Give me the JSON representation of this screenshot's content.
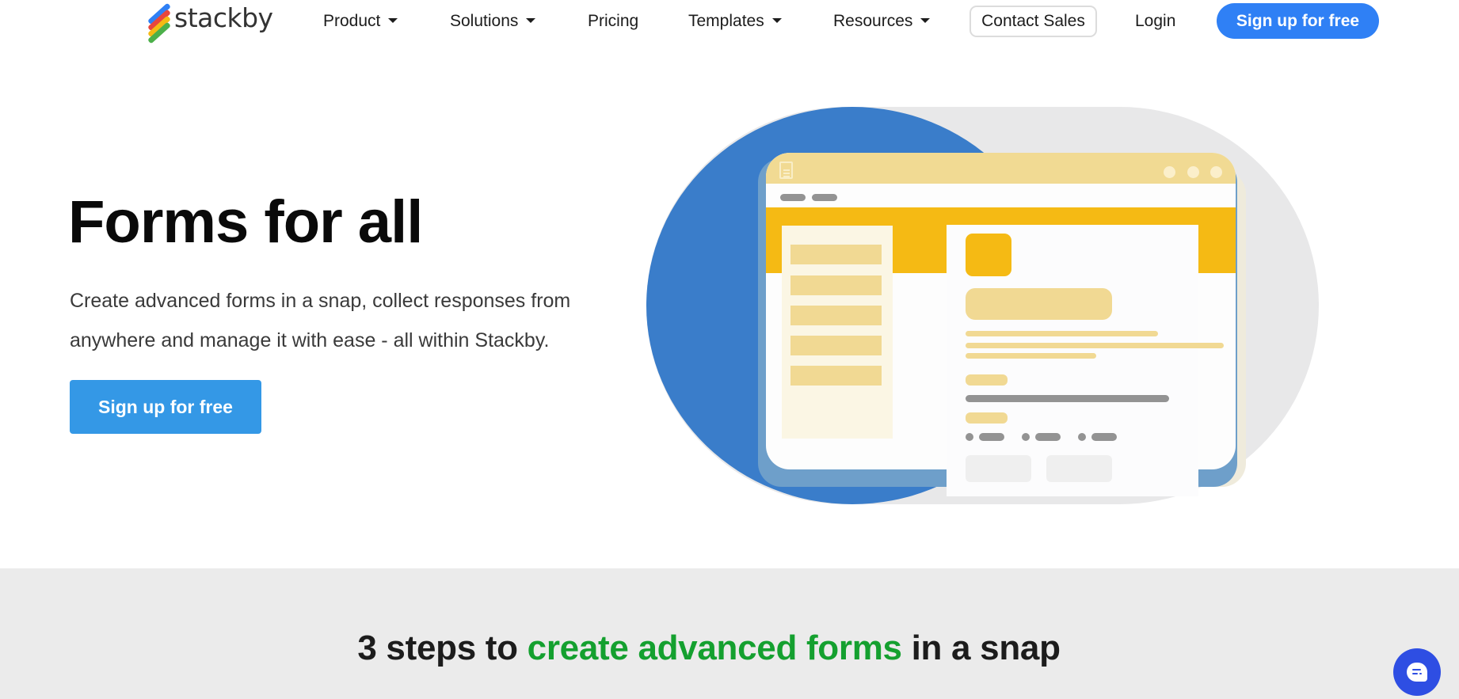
{
  "brand": {
    "name": "stackby",
    "logo_colors": [
      "#2f80f5",
      "#e8463c",
      "#f5ba14",
      "#4cb04a"
    ]
  },
  "nav": {
    "items": [
      {
        "label": "Product",
        "dropdown": true
      },
      {
        "label": "Solutions",
        "dropdown": true
      },
      {
        "label": "Pricing",
        "dropdown": false
      },
      {
        "label": "Templates",
        "dropdown": true
      },
      {
        "label": "Resources",
        "dropdown": true
      }
    ],
    "contact_sales": "Contact Sales",
    "login": "Login",
    "signup": "Sign up for free"
  },
  "hero": {
    "title": "Forms for all",
    "subtitle_line1": "Create advanced forms in a snap, collect responses from",
    "subtitle_line2": "anywhere and manage it with ease - all within Stackby.",
    "cta": "Sign up for free"
  },
  "illustration": {
    "description": "form builder window mockup",
    "colors": {
      "blue": "#3a7dca",
      "yellow": "#f5ba14",
      "pale_yellow": "#f1d993",
      "gray": "#939393"
    }
  },
  "steps": {
    "title_prefix": "3 steps to ",
    "title_highlight": "create advanced forms",
    "title_suffix": " in a snap",
    "highlight_color": "#14a02f"
  },
  "chat": {
    "icon": "chat-bubble-icon",
    "color": "#2e4ee3"
  }
}
